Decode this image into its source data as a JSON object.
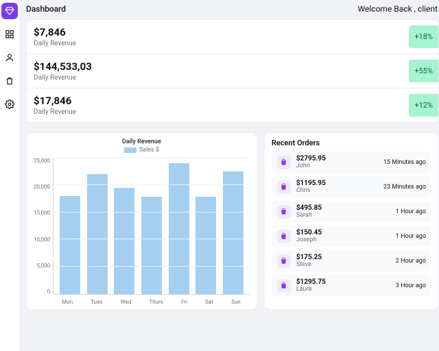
{
  "header": {
    "title": "Dashboard",
    "welcome": "Welcome Back , client"
  },
  "kpis": [
    {
      "value": "$7,846",
      "label": "Daily Revenue",
      "delta": "+18%"
    },
    {
      "value": "$144,533,03",
      "label": "Daily Revenue",
      "delta": "+55%"
    },
    {
      "value": "$17,846",
      "label": "Daily Revenue",
      "delta": "+12%"
    }
  ],
  "orders_title": "Recent Orders",
  "orders": [
    {
      "amount": "$2795.95",
      "name": "John",
      "time": "15 Minutes ago"
    },
    {
      "amount": "$1195.95",
      "name": "Chris",
      "time": "23 Minutes ago"
    },
    {
      "amount": "$495.85",
      "name": "Sarah",
      "time": "1 Hour ago"
    },
    {
      "amount": "$150.45",
      "name": "Joseph",
      "time": "1 Hour ago"
    },
    {
      "amount": "$175.25",
      "name": "Steve",
      "time": "2 Hour ago"
    },
    {
      "amount": "$1295.75",
      "name": "Laura",
      "time": "3 Hour ago"
    }
  ],
  "chart_data": {
    "type": "bar",
    "title": "Daily Revenue",
    "legend": "Sales $",
    "xlabel": "",
    "ylabel": "",
    "ylim": [
      0,
      25000
    ],
    "yticks": [
      "25,000",
      "20,000",
      "15,000",
      "10,000",
      "5,000",
      "0"
    ],
    "categories": [
      "Mon",
      "Tues",
      "Wed",
      "Thurs",
      "Fri",
      "Sat",
      "Sun"
    ],
    "values": [
      18000,
      22000,
      19500,
      17800,
      24000,
      17900,
      22500
    ]
  }
}
